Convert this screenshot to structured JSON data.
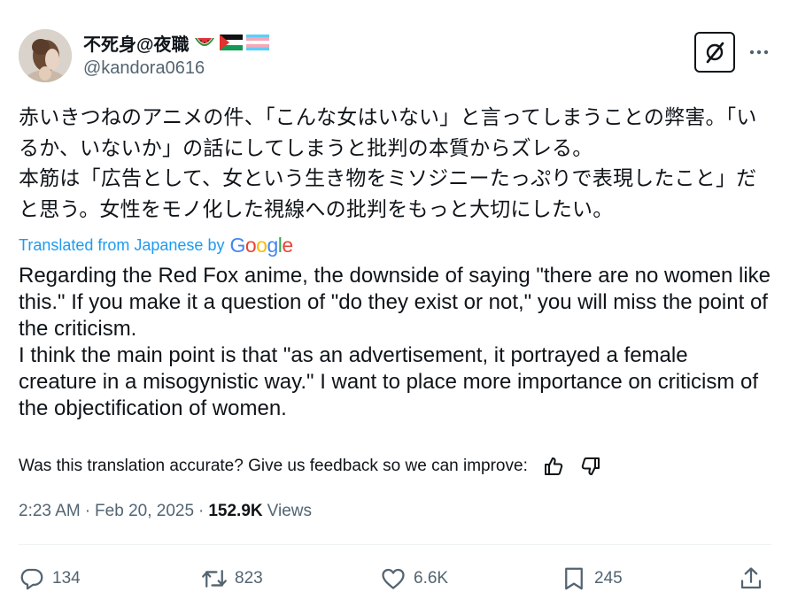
{
  "author": {
    "display_name": "不死身@夜職",
    "handle": "@kandora0616",
    "name_emojis": [
      "watermelon-icon",
      "palestine-flag-icon",
      "transgender-flag-icon"
    ]
  },
  "tweet": {
    "original_text": "赤いきつねのアニメの件、「こんな女はいない」と言ってしまうことの弊害。「いるか、いないか」の話にしてしまうと批判の本質からズレる。\n本筋は「広告として、女という生き物をミソジニーたっぷりで表現したこと」だと思う。女性をモノ化した視線への批判をもっと大切にしたい。",
    "translated_label": "Translated from Japanese by",
    "translation_provider": "Google",
    "translated_text": "Regarding the Red Fox anime, the downside of saying \"there are no women like this.\" If you make it a question of \"do they exist or not,\" you will miss the point of the criticism.\nI think the main point is that \"as an advertisement, it portrayed a female creature in a misogynistic way.\" I want to place more importance on criticism of the objectification of women.",
    "feedback_prompt": "Was this translation accurate? Give us feedback so we can improve:"
  },
  "meta": {
    "time": "2:23 AM",
    "separator": "·",
    "date": "Feb 20, 2025",
    "views_count": "152.9K",
    "views_label": "Views"
  },
  "actions": {
    "replies": "134",
    "reposts": "823",
    "likes": "6.6K",
    "bookmarks": "245"
  },
  "colors": {
    "text": "#0f1419",
    "secondary": "#536471",
    "link": "#1d9bf0",
    "divider": "#eff3f4"
  }
}
